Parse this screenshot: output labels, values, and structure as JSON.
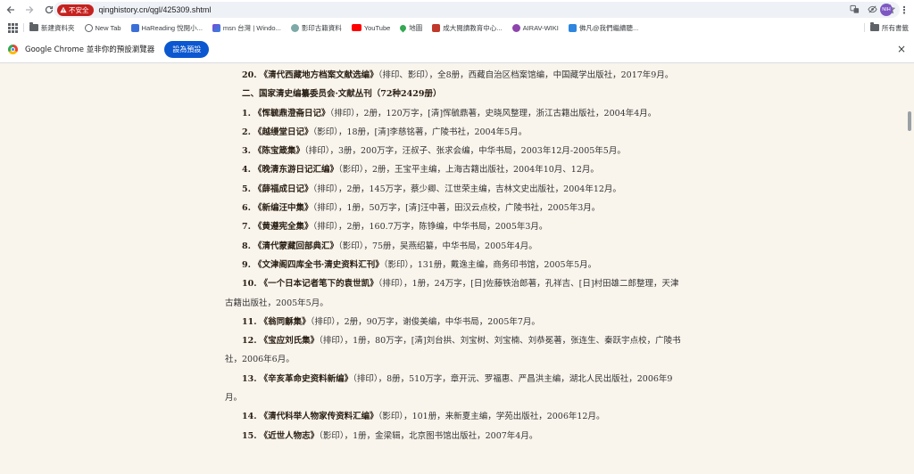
{
  "browser": {
    "insecure_label": "不安全",
    "url": "qinghistory.cn/qgl/425309.shtml",
    "profile_initials": "NIH"
  },
  "bookmarks": {
    "items": [
      {
        "label": "新建資料夾",
        "icon": "folder-icon",
        "color": "#5f6368"
      },
      {
        "label": "New Tab",
        "icon": "globe-icon",
        "color": "#5f6368"
      },
      {
        "label": "HaReading 悅閱小...",
        "icon": "hareading-icon",
        "color": "#3b6fd8"
      },
      {
        "label": "msn 台灣 | Windo...",
        "icon": "msn-icon",
        "color": "#7b4ad8"
      },
      {
        "label": "影印古籍資料",
        "icon": "globe-icon",
        "color": "#7da9a8"
      },
      {
        "label": "YouTube",
        "icon": "youtube-icon",
        "color": "#ff0000"
      },
      {
        "label": "地圖",
        "icon": "maps-icon",
        "color": "#34a853"
      },
      {
        "label": "成大閱讀教育中心...",
        "icon": "ncku-icon",
        "color": "#c0392b"
      },
      {
        "label": "AIRAV-WIKI",
        "icon": "airav-icon",
        "color": "#8e44ad"
      },
      {
        "label": "佛凡@我們繼續聽...",
        "icon": "bookmark-icon",
        "color": "#2e86de"
      }
    ],
    "all_bookmarks_label": "所有書籤"
  },
  "infobar": {
    "message": "Google Chrome 並非你的預設瀏覽器",
    "button_label": "設為預設"
  },
  "article": {
    "paragraphs": [
      {
        "num": "20.",
        "title": "《清代西藏地方档案文献选编》",
        "rest": "（排印、影印），全8册，西藏自治区档案馆编，中国藏学出版社，2017年9月。"
      },
      {
        "heading": "二、国家清史编纂委员会·文献丛刊（72种2429册）"
      },
      {
        "num": "1.",
        "title": "《恽毓鼎澄斋日记》",
        "rest": "（排印），2册，120万字，[清]恽毓鼎著，史晓风整理，浙江古籍出版社，2004年4月。"
      },
      {
        "num": "2.",
        "title": "《越缦堂日记》",
        "rest": "（影印），18册，[清]李慈铭著，广陵书社，2004年5月。"
      },
      {
        "num": "3.",
        "title": "《陈宝箴集》",
        "rest": "（排印），3册，200万字，汪叔子、张求会编，中华书局，2003年12月-2005年5月。"
      },
      {
        "num": "4.",
        "title": "《晚清东游日记汇编》",
        "rest": "（影印），2册，王宝平主编，上海古籍出版社，2004年10月、12月。"
      },
      {
        "num": "5.",
        "title": "《薛福成日记》",
        "rest": "（排印），2册，145万字，蔡少卿、江世荣主编，吉林文史出版社，2004年12月。"
      },
      {
        "num": "6.",
        "title": "《新编汪中集》",
        "rest": "（排印），1册，50万字，[清]汪中著，田汉云点校，广陵书社，2005年3月。"
      },
      {
        "num": "7.",
        "title": "《黄遵宪全集》",
        "rest": "（排印），2册，160.7万字，陈铮编，中华书局，2005年3月。"
      },
      {
        "num": "8.",
        "title": "《清代蒙藏回部典汇》",
        "rest": "（影印），75册，吴燕绍纂，中华书局，2005年4月。"
      },
      {
        "num": "9.",
        "title": "《文津阁四库全书·清史资料汇刊》",
        "rest": "（影印），131册，戴逸主编，商务印书馆，2005年5月。"
      },
      {
        "num": "10.",
        "title": "《一个日本记者笔下的袁世凯》",
        "rest": "（排印），1册，24万字，[日]佐藤铁治郎著，孔祥吉、[日]村田雄二郎整理，天津古籍出版社，2005年5月。"
      },
      {
        "num": "11.",
        "title": "《翁同龢集》",
        "rest": "（排印），2册，90万字，谢俊美编，中华书局，2005年7月。"
      },
      {
        "num": "12.",
        "title": "《宝应刘氏集》",
        "rest": "（排印），1册，80万字，[清]刘台拱、刘宝树、刘宝楠、刘恭冕著，张连生、秦跃宇点校，广陵书社，2006年6月。"
      },
      {
        "num": "13.",
        "title": "《辛亥革命史资料新编》",
        "rest": "（排印），8册，510万字，章开沅、罗福惠、严昌洪主编，湖北人民出版社，2006年9月。"
      },
      {
        "num": "14.",
        "title": "《清代科举人物家传资料汇编》",
        "rest": "（影印），101册，来新夏主编，学苑出版社，2006年12月。"
      },
      {
        "num": "15.",
        "title": "《近世人物志》",
        "rest": "（影印），1册，金梁辑，北京图书馆出版社，2007年4月。"
      }
    ]
  }
}
